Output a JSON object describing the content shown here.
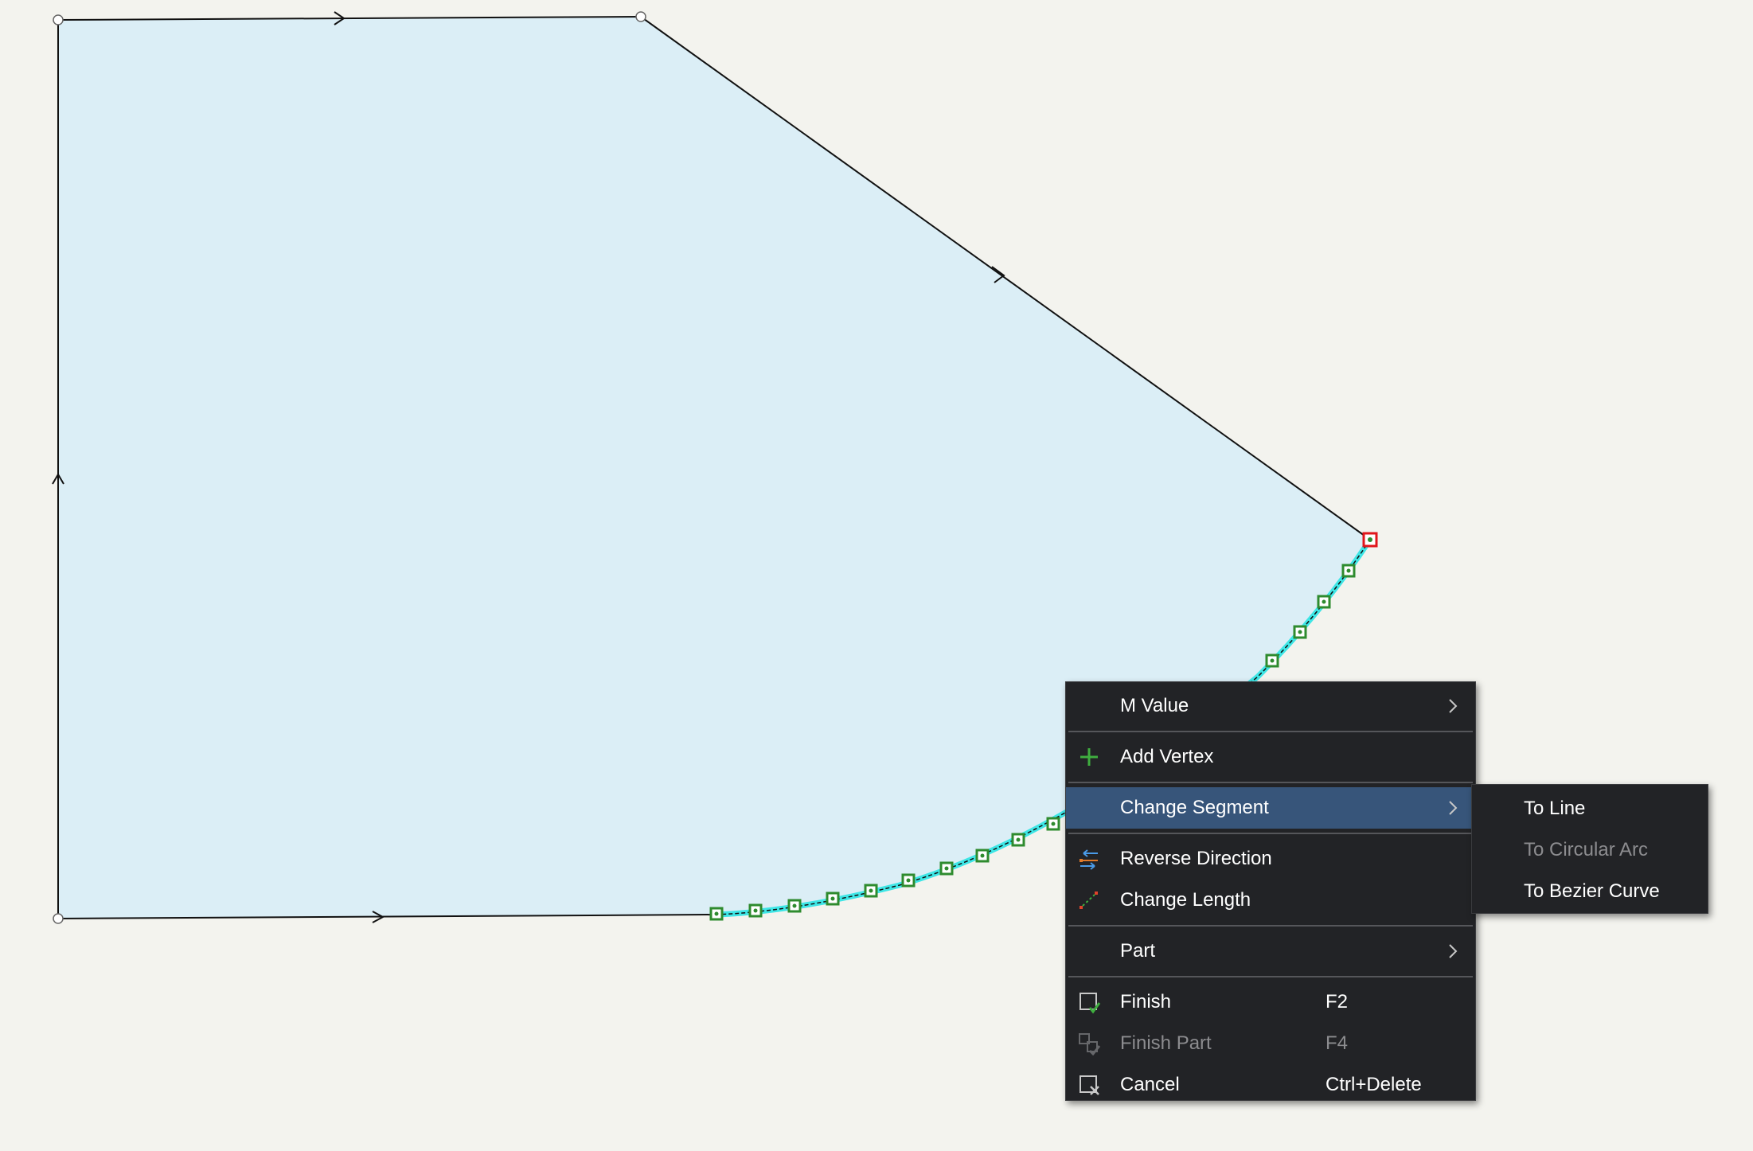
{
  "canvas": {
    "polygon_fill": "#dbeef6",
    "edge_color": "#111111",
    "selected_segment_color": "#3ee6e6",
    "vertex_color_green": "#2e8b2e",
    "vertex_color_selected": "#e0161b"
  },
  "context_menu": {
    "items": [
      {
        "label": "M Value",
        "mnemonic": "M",
        "has_submenu": true
      },
      {
        "label": "Add Vertex",
        "mnemonic": "A",
        "icon": "plus-icon"
      },
      {
        "label": "Change Segment",
        "mnemonic": "C",
        "has_submenu": true,
        "highlighted": true
      },
      {
        "label": "Reverse Direction",
        "mnemonic": "R",
        "icon": "reverse-direction-icon"
      },
      {
        "label": "Change Length",
        "icon": "change-length-icon"
      },
      {
        "label": "Part",
        "mnemonic": "P",
        "has_submenu": true
      },
      {
        "label": "Finish",
        "mnemonic": "F",
        "shortcut": "F2",
        "icon": "finish-icon"
      },
      {
        "label": "Finish Part",
        "mnemonic": "i",
        "shortcut": "F4",
        "icon": "finish-part-icon",
        "disabled": true
      },
      {
        "label": "Cancel",
        "mnemonic": "n",
        "shortcut": "Ctrl+Delete",
        "icon": "cancel-icon"
      }
    ]
  },
  "submenu": {
    "items": [
      {
        "label": "To Line",
        "mnemonic": "T"
      },
      {
        "label": "To Circular Arc",
        "mnemonic": "C",
        "disabled": true
      },
      {
        "label": "To Bezier Curve",
        "mnemonic": "B"
      }
    ]
  },
  "colors": {
    "background": "#f3f3ee",
    "menu_bg": "#222326",
    "menu_highlight": "#37557a",
    "menu_text": "#ffffff",
    "menu_text_disabled": "#8c8c8f"
  }
}
